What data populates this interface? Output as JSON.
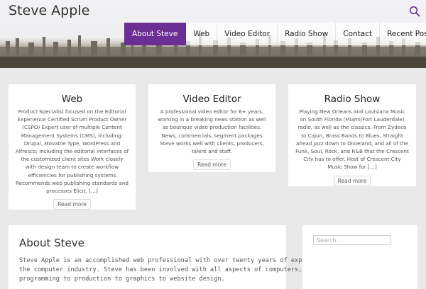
{
  "site": {
    "title": "Steve Apple"
  },
  "nav": {
    "items": [
      {
        "label": "About Steve",
        "active": true
      },
      {
        "label": "Web"
      },
      {
        "label": "Video Editor"
      },
      {
        "label": "Radio Show"
      },
      {
        "label": "Contact"
      },
      {
        "label": "Recent Posts"
      }
    ]
  },
  "icons": {
    "search": "search-icon"
  },
  "colors": {
    "accent": "#6a2e94"
  },
  "cards": [
    {
      "title": "Web",
      "text": "Product Specialist focused on the Editorial Experience Certified Scrum Product Owner (CSPO) Expert user of multiple Content Management Systems (CMS), including: Drupal, Movable Type, WordPress and Alfresco; including the editorial interfaces of the customized client sites Work closely with design team to create workflow efficiencies for publishing systems Recommends web publishing standards and processes Elicit, […]",
      "button": "Read more"
    },
    {
      "title": "Video Editor",
      "text": "A professional video editor for 6+ years, working in a breaking news station as well as boutique video production facilities. News, commercials, segment packages Steve works well with clients, producers, talent and staff.",
      "button": "Read more"
    },
    {
      "title": "Radio Show",
      "text": "Playing New Orleans and Louisiana Music on South Florida (Miami/Fort Lauderdale) radio, as well as the classics. From Zydeco to Cajun, Brass Bands to Blues, Straight ahead Jazz down to Dixieland, and all of the Funk, Soul, Rock, and R&B that the Crescent City has to offer. Host of Crescent City Music Show for […]",
      "button": "Read more"
    }
  ],
  "about": {
    "title": "About Steve",
    "text": "Steve Apple is an accomplished web professional with over twenty years of experience in the computer industry. Steve has been involved with all aspects of computers, from programming to production to graphics to website design."
  },
  "sidebar": {
    "search_placeholder": "Search …"
  }
}
